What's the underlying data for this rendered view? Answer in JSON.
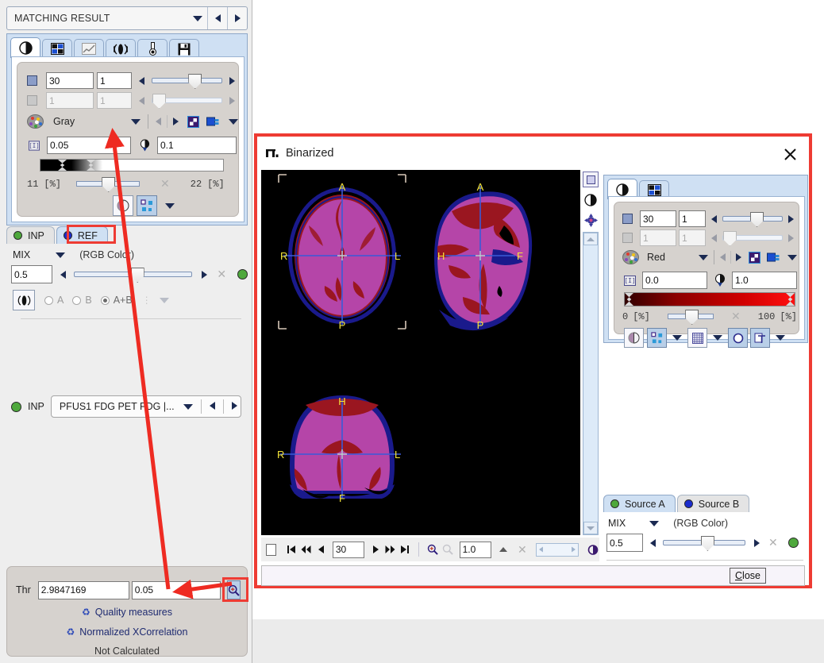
{
  "left_panel": {
    "title": "MATCHING RESULT",
    "tabs": [
      {
        "name": "contrast-tab",
        "icon": "contrast-icon",
        "active": true
      },
      {
        "name": "layout-tab",
        "icon": "grid-icon",
        "active": false
      },
      {
        "name": "curve-tab",
        "icon": "chart-icon",
        "active": false
      },
      {
        "name": "fusion-tab",
        "icon": "radial-icon",
        "active": false
      },
      {
        "name": "probe-tab",
        "icon": "thermometer-icon",
        "active": false
      },
      {
        "name": "save-tab",
        "icon": "floppy-icon",
        "active": false
      }
    ],
    "slice_value": "30",
    "slice_step": "1",
    "slice2_value": "1",
    "slice2_step": "1",
    "colortable": "Gray",
    "lower_threshold": "0.05",
    "upper_threshold": "0.1",
    "pct_min": "11",
    "pct_min_unit": "[%]",
    "pct_max": "22",
    "pct_max_unit": "[%]",
    "source_tabs": [
      {
        "label": "INP",
        "dot": "green",
        "active": false
      },
      {
        "label": "REF",
        "dot": "blue",
        "active": true
      }
    ],
    "mix_label": "MIX",
    "mix_mode": "(RGB Color)",
    "mix_value": "0.5",
    "radios": [
      {
        "label": "A",
        "selected": false
      },
      {
        "label": "B",
        "selected": false
      },
      {
        "label": "A+B",
        "selected": true
      }
    ],
    "input_row": {
      "label": "INP",
      "series": "PFUS1 FDG PET FDG |..."
    },
    "threshold_card": {
      "thr_label": "Thr",
      "thr_value": "2.9847169",
      "thr_fraction": "0.05",
      "zoom_icon": "magnifier-plus-icon",
      "quality_measures": "Quality measures",
      "normalized_xcorrelation": "Normalized XCorrelation",
      "status": "Not Calculated"
    }
  },
  "dialog": {
    "title": "Binarized",
    "title_icon": "binarized-icon",
    "close_icon": "close-icon",
    "views": [
      {
        "name": "transverse-view",
        "orientation_labels": [
          "A",
          "R",
          "L",
          "P"
        ]
      },
      {
        "name": "sagittal-view",
        "orientation_labels": [
          "A",
          "H",
          "F",
          "P"
        ]
      },
      {
        "name": "coronal-view",
        "orientation_labels": [
          "H",
          "R",
          "L",
          "F"
        ]
      }
    ],
    "side_toolbar": [
      {
        "name": "square-icon"
      },
      {
        "name": "contrast-icon"
      },
      {
        "name": "crosshair-icon"
      }
    ],
    "controls": {
      "tabs": [
        {
          "name": "contrast-tab",
          "icon": "contrast-icon",
          "active": true
        },
        {
          "name": "layout-tab",
          "icon": "grid-icon",
          "active": false
        }
      ],
      "slice_value": "30",
      "slice_step": "1",
      "slice2_value": "1",
      "slice2_step": "1",
      "colortable": "Red",
      "lower_threshold": "0.0",
      "upper_threshold": "1.0",
      "pct_min": "0",
      "pct_min_unit": "[%]",
      "pct_max": "100",
      "pct_max_unit": "[%]"
    },
    "source_tabs": [
      {
        "label": "Source A",
        "dot": "green",
        "active": true
      },
      {
        "label": "Source B",
        "dot": "blue",
        "active": false
      }
    ],
    "mix_label": "MIX",
    "mix_mode": "(RGB Color)",
    "mix_value": "0.5",
    "navbar": {
      "frame_value": "30",
      "zoom_value": "1.0",
      "first_icon": "skip-first-icon",
      "prev_fast_icon": "rewind-icon",
      "prev_icon": "prev-icon",
      "next_icon": "next-icon",
      "next_fast_icon": "fast-forward-icon",
      "last_icon": "skip-last-icon",
      "zoom_in_icon": "zoom-in-icon",
      "zoom_out_icon": "zoom-out-icon"
    },
    "close_button": "Close"
  },
  "colors": {
    "accent_red": "#ee3b33",
    "panel_blue": "#cfe0f3",
    "card_gray": "#d6d2ce",
    "green_dot": "#4ea83c",
    "blue_dot": "#1b2ccd",
    "brain_magenta": "#b545a8",
    "brain_dark_red": "#9a1620",
    "brain_blue": "#1a1a8c"
  }
}
